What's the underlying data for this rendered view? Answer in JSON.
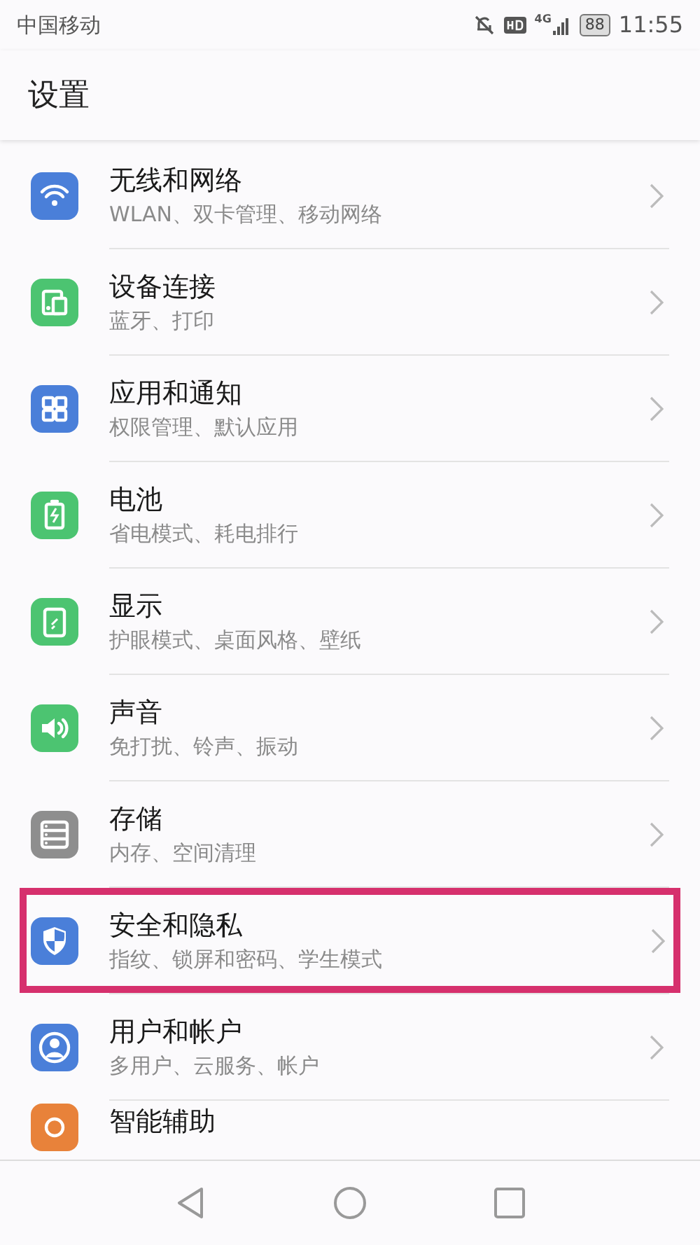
{
  "status_bar": {
    "carrier": "中国移动",
    "network": "4G",
    "battery": "88",
    "time": "11:55"
  },
  "title": "设置",
  "items": [
    {
      "title": "无线和网络",
      "subtitle": "WLAN、双卡管理、移动网络",
      "color": "#4a7fd9",
      "highlighted": false
    },
    {
      "title": "设备连接",
      "subtitle": "蓝牙、打印",
      "color": "#4cc471",
      "highlighted": false
    },
    {
      "title": "应用和通知",
      "subtitle": "权限管理、默认应用",
      "color": "#4a7fd9",
      "highlighted": false
    },
    {
      "title": "电池",
      "subtitle": "省电模式、耗电排行",
      "color": "#4cc471",
      "highlighted": false
    },
    {
      "title": "显示",
      "subtitle": "护眼模式、桌面风格、壁纸",
      "color": "#4cc471",
      "highlighted": false
    },
    {
      "title": "声音",
      "subtitle": "免打扰、铃声、振动",
      "color": "#4cc471",
      "highlighted": false
    },
    {
      "title": "存储",
      "subtitle": "内存、空间清理",
      "color": "#8e8e8e",
      "highlighted": false
    },
    {
      "title": "安全和隐私",
      "subtitle": "指纹、锁屏和密码、学生模式",
      "color": "#4a7fd9",
      "highlighted": true
    },
    {
      "title": "用户和帐户",
      "subtitle": "多用户、云服务、帐户",
      "color": "#4a7fd9",
      "highlighted": false
    },
    {
      "title": "智能辅助",
      "color": "#e8823a",
      "highlighted": false
    }
  ]
}
